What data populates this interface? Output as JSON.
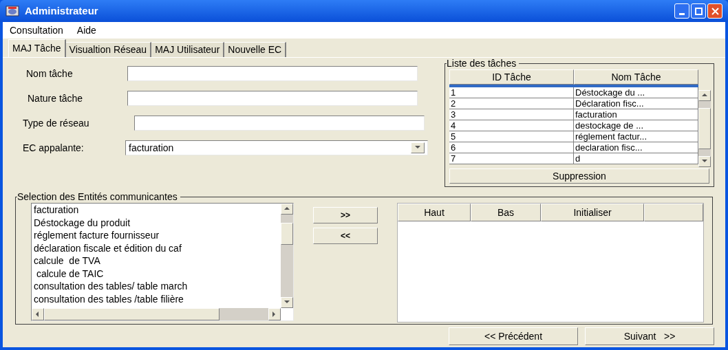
{
  "window": {
    "title": "Administrateur"
  },
  "menu": [
    "Consultation",
    "Aide"
  ],
  "tabs": [
    {
      "label": "MAJ Tâche",
      "selected": true
    },
    {
      "label": "Visualtion Réseau",
      "selected": false
    },
    {
      "label": "MAJ Utilisateur",
      "selected": false
    },
    {
      "label": "Nouvelle EC",
      "selected": false
    }
  ],
  "form": {
    "fields": [
      {
        "kind": "text",
        "label": "Nom tâche"
      },
      {
        "kind": "text",
        "label": "Nature tâche"
      },
      {
        "kind": "text",
        "label": "Type de réseau"
      },
      {
        "kind": "combo",
        "label": "EC appalante:",
        "value": "facturation"
      }
    ]
  },
  "tasks": {
    "title": "Liste des tâches",
    "columns": [
      "ID Tâche",
      "Nom Tâche"
    ],
    "partial_row_selected": true,
    "rows": [
      [
        "1",
        "Déstockage du ..."
      ],
      [
        "2",
        "Déclaration  fisc..."
      ],
      [
        "3",
        "facturation"
      ],
      [
        "4",
        "destockage de ..."
      ],
      [
        "5",
        "réglement factur..."
      ],
      [
        "6",
        "declaration  fisc..."
      ],
      [
        "7",
        "d"
      ]
    ],
    "delete_button": "Suppression"
  },
  "selection": {
    "title": "Selection des Entités communicantes",
    "items": [
      "facturation",
      "Déstockage du produit",
      "réglement facture fournisseur",
      "déclaration fiscale et édition du caf",
      "calcule  de TVA",
      " calcule de TAIC",
      "consultation des tables/ table march",
      "consultation des tables /table filière"
    ],
    "add_button": ">>",
    "remove_button": "<<",
    "order_buttons": [
      "Haut",
      "Bas",
      "Initialiser"
    ]
  },
  "footer_buttons": [
    "<< Précédent",
    "Suivant   >>"
  ]
}
